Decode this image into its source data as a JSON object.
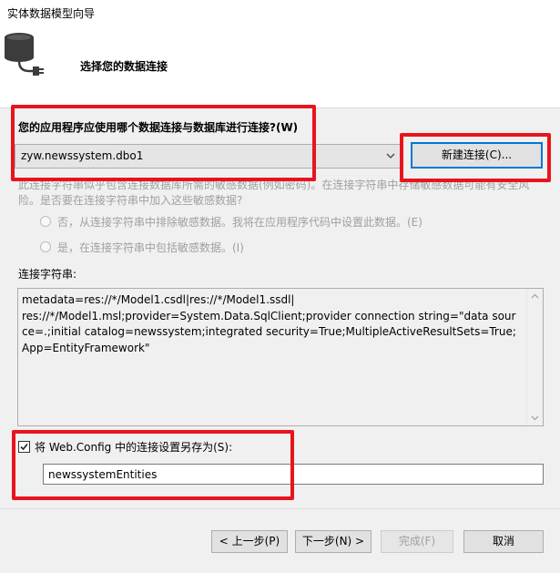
{
  "window": {
    "title": "实体数据模型向导"
  },
  "header": {
    "title": "选择您的数据连接",
    "icon": "database-plug-icon"
  },
  "connection": {
    "question": "您的应用程序应使用哪个数据连接与数据库进行连接?(W)",
    "selected": "zyw.newssystem.dbo1",
    "new_button": "新建连接(C)..."
  },
  "sensitive": {
    "description": "此连接字符串似乎包含连接数据库所需的敏感数据(例如密码)。在连接字符串中存储敏感数据可能有安全风险。是否要在连接字符串中加入这些敏感数据?",
    "option_exclude": "否，从连接字符串中排除敏感数据。我将在应用程序代码中设置此数据。(E)",
    "option_include": "是，在连接字符串中包括敏感数据。(I)"
  },
  "connection_string": {
    "label": "连接字符串:",
    "value": "metadata=res://*/Model1.csdl|res://*/Model1.ssdl|\nres://*/Model1.msl;provider=System.Data.SqlClient;provider connection string=\"data source=.;initial catalog=newssystem;integrated security=True;MultipleActiveResultSets=True;App=EntityFramework\""
  },
  "save": {
    "label": "将 Web.Config 中的连接设置另存为(S):",
    "checked": true,
    "value": "newssystemEntities"
  },
  "buttons": {
    "back": "< 上一步(P)",
    "next": "下一步(N) >",
    "finish": "完成(F)",
    "cancel": "取消"
  },
  "colors": {
    "highlight": "#e8141c",
    "accent": "#0078d7"
  }
}
